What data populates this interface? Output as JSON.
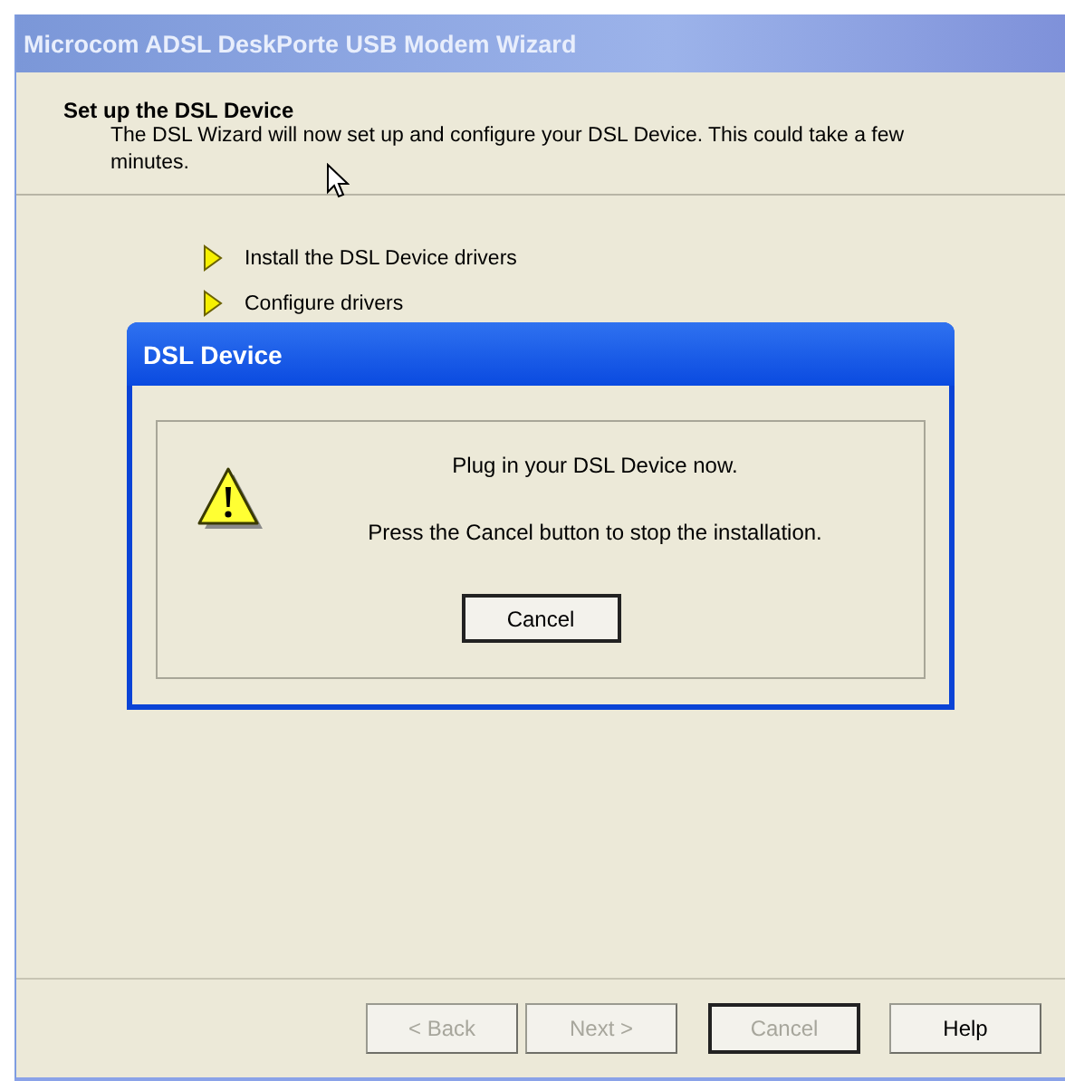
{
  "window": {
    "title": "Microcom ADSL DeskPorte USB Modem Wizard"
  },
  "header": {
    "title": "Set up the DSL Device",
    "description": "The DSL Wizard will now set up and configure your DSL Device. This could take a few minutes."
  },
  "steps": [
    {
      "label": "Install the DSL Device drivers"
    },
    {
      "label": "Configure drivers"
    }
  ],
  "dialog": {
    "title": "DSL Device",
    "message": "Plug in your DSL Device now.",
    "note": "Press the Cancel button to stop the installation.",
    "button": {
      "label": "Cancel",
      "default": true,
      "disabled": false
    }
  },
  "buttons": [
    {
      "label": "< Back",
      "disabled": true,
      "default": false
    },
    {
      "label": "Next >",
      "disabled": true,
      "default": false
    },
    {
      "label": "Cancel",
      "disabled": true,
      "default": true
    },
    {
      "label": "Help",
      "disabled": false,
      "default": false
    }
  ]
}
